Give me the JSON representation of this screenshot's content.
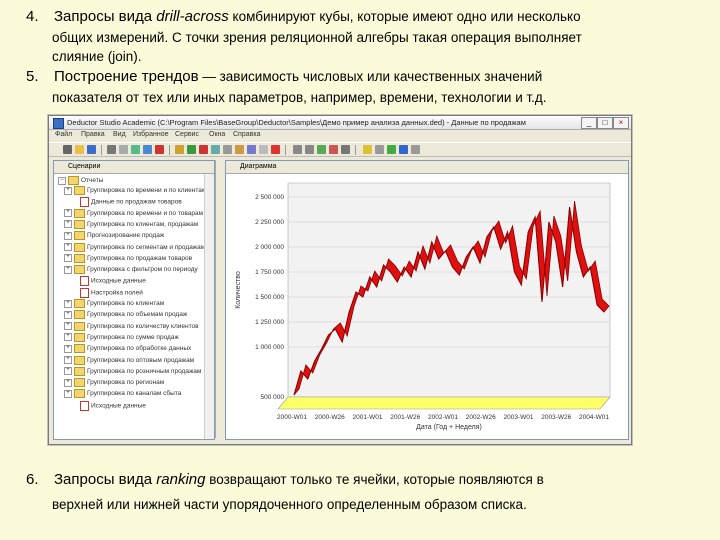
{
  "items": [
    {
      "number": "4.",
      "lead_before": "Запросы вида ",
      "lead_em": "drill-across",
      "lead_after": " комбинируют кубы, которые имеют одно или несколько",
      "cont": [
        "общих измерений. С точки зрения реляционной алгебры такая операция выполняет",
        "слияние (join)."
      ]
    },
    {
      "number": "5.",
      "lead_before": "Построение трендов",
      "lead_em": "",
      "lead_after": " — зависимость числовых или качественных значений",
      "cont": [
        "показателя от тех или иных параметров, например, времени, технологии и т.д."
      ]
    },
    {
      "number": "6.",
      "lead_before": "Запросы вида ",
      "lead_em": "ranking",
      "lead_after": " возвращают только те ячейки, которые появляются в",
      "cont": [
        "верхней или нижней части упорядоченного определенным образом списка."
      ]
    }
  ],
  "window": {
    "title": "Deductor Studio Academic (C:\\Program Files\\BaseGroup\\Deductor\\Samples\\Демо пример анализа данных.ded) - Данные по продажам",
    "menu": [
      "Файл",
      "Правка",
      "Вид",
      "Избранное",
      "Сервис",
      "Окна",
      "Справка"
    ],
    "left_tab": "Сценарии",
    "left_root": "Отчеты",
    "right_tab": "Диаграмма",
    "tree": [
      "Группировка по времени и по клиентам",
      "Данные по продажам товаров",
      "Группировка по времени и по товарам",
      "Группировка по клиентам, продажам",
      "Прогнозирование продаж",
      "Группировка по сегментам и продажам",
      "Группировка по продажам товаров",
      "Группировка с фильтром по периоду",
      "Исходные данные",
      "Настройка полей",
      "Группировка по клиентам",
      "Группировка по объемам продаж",
      "Группировка по количеству клиентов",
      "Группировка по сумме продаж",
      "Группировка по обработке данных",
      "Группировка по оптовым продажам",
      "Группировка по розничным продажам",
      "Группировка по регионам",
      "Группировка по каналам сбыта",
      "Исходные данные"
    ]
  },
  "chart_data": {
    "type": "line",
    "ylabel": "Количество",
    "xlabel": "Дата (Год + Неделя)",
    "yticks": [
      "500 000",
      "1 000 000",
      "1 250 000",
      "1 500 000",
      "1 750 000",
      "2 000 000",
      "2 250 000",
      "2 500 000"
    ],
    "xticks": [
      "2000-W01",
      "2000-W26",
      "2001-W01",
      "2001-W26",
      "2002-W01",
      "2002-W26",
      "2003-W01",
      "2003-W26",
      "2004-W01"
    ],
    "ylim": [
      500000,
      2500000
    ],
    "colors": {
      "line": "#e01010",
      "line_dark": "#8a0000",
      "floor": "#ffff66"
    },
    "values": [
      520000,
      760000,
      680000,
      860000,
      980000,
      1120000,
      1180000,
      1050000,
      1350000,
      1550000,
      1500000,
      1700000,
      1600000,
      1820000,
      1750000,
      1650000,
      1800000,
      1700000,
      1950000,
      1780000,
      2050000,
      1880000,
      1960000,
      1800000,
      1720000,
      1900000,
      2000000,
      1840000,
      2100000,
      2200000,
      1980000,
      2150000,
      1750000,
      1620000,
      2150000,
      2300000,
      1450000,
      2250000,
      2050000,
      1600000,
      2400000,
      1950000,
      1700000,
      1800000,
      1420000,
      1350000
    ]
  }
}
